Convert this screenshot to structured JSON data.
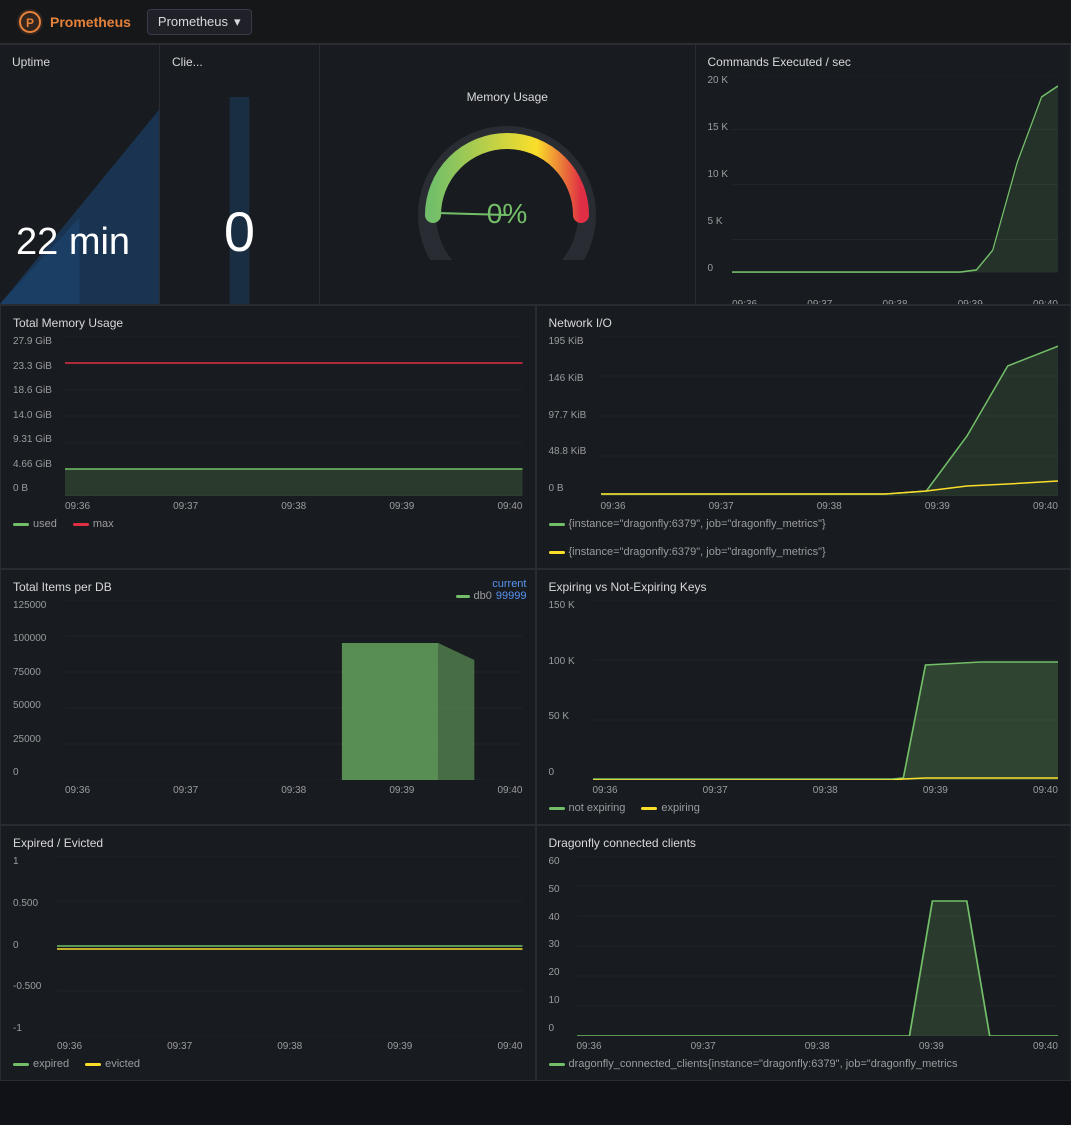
{
  "topbar": {
    "logo_text": "Prometheus",
    "datasource_label": "Prometheus",
    "dropdown_arrow": "▾"
  },
  "panels": {
    "uptime": {
      "title": "Uptime",
      "value": "22 min"
    },
    "clients": {
      "title": "Clie...",
      "value": "0"
    },
    "memory_usage": {
      "title": "Memory Usage",
      "value": "0%"
    },
    "commands_per_sec": {
      "title": "Commands Executed / sec",
      "y_labels": [
        "20 K",
        "15 K",
        "10 K",
        "5 K",
        "0"
      ],
      "x_labels": [
        "09:36",
        "09:37",
        "09:38",
        "09:39",
        "09:40"
      ]
    },
    "total_memory": {
      "title": "Total Memory Usage",
      "y_labels": [
        "27.9 GiB",
        "23.3 GiB",
        "18.6 GiB",
        "14.0 GiB",
        "9.31 GiB",
        "4.66 GiB",
        "0 B"
      ],
      "x_labels": [
        "09:36",
        "09:37",
        "09:38",
        "09:39",
        "09:40"
      ],
      "legend": [
        {
          "label": "used",
          "color": "#73bf69"
        },
        {
          "label": "max",
          "color": "#e02f44"
        }
      ]
    },
    "network_io": {
      "title": "Network I/O",
      "y_labels": [
        "195 KiB",
        "146 KiB",
        "97.7 KiB",
        "48.8 KiB",
        "0 B"
      ],
      "x_labels": [
        "09:36",
        "09:37",
        "09:38",
        "09:39",
        "09:40"
      ],
      "legend": [
        {
          "label": "{instance=\"dragonfly:6379\", job=\"dragonfly_metrics\"}",
          "color": "#73bf69"
        },
        {
          "label": "{instance=\"dragonfly:6379\", job=\"dragonfly_metrics\"}",
          "color": "#fade2a"
        }
      ]
    },
    "total_items_per_db": {
      "title": "Total Items per DB",
      "y_labels": [
        "125000",
        "100000",
        "75000",
        "50000",
        "25000",
        "0"
      ],
      "x_labels": [
        "09:36",
        "09:37",
        "09:38",
        "09:39",
        "09:40"
      ],
      "current_label": "current",
      "legend": [
        {
          "label": "db0",
          "color": "#73bf69",
          "value": "99999"
        }
      ]
    },
    "expiring_keys": {
      "title": "Expiring vs Not-Expiring Keys",
      "y_labels": [
        "150 K",
        "100 K",
        "50 K",
        "0"
      ],
      "x_labels": [
        "09:36",
        "09:37",
        "09:38",
        "09:39",
        "09:40"
      ],
      "legend": [
        {
          "label": "not expiring",
          "color": "#73bf69"
        },
        {
          "label": "expiring",
          "color": "#fade2a"
        }
      ]
    },
    "expired_evicted": {
      "title": "Expired / Evicted",
      "y_labels": [
        "1",
        "0.500",
        "0",
        "-0.500",
        "-1"
      ],
      "x_labels": [
        "09:36",
        "09:37",
        "09:38",
        "09:39",
        "09:40"
      ],
      "legend": [
        {
          "label": "expired",
          "color": "#73bf69"
        },
        {
          "label": "evicted",
          "color": "#fade2a"
        }
      ]
    },
    "connected_clients": {
      "title": "Dragonfly connected clients",
      "y_labels": [
        "60",
        "50",
        "40",
        "30",
        "20",
        "10",
        "0"
      ],
      "x_labels": [
        "09:36",
        "09:37",
        "09:38",
        "09:39",
        "09:40"
      ],
      "legend": [
        {
          "label": "dragonfly_connected_clients{instance=\"dragonfly:6379\", job=\"dragonfly_metrics",
          "color": "#73bf69"
        }
      ]
    }
  }
}
